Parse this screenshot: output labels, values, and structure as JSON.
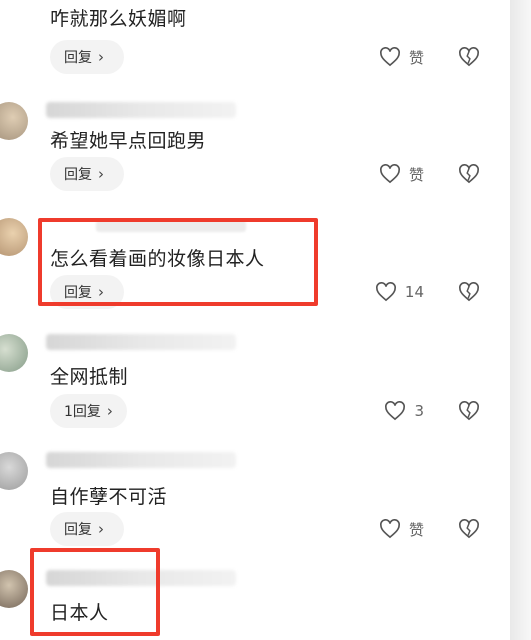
{
  "comments": [
    {
      "text": "咋就那么妖媚啊",
      "reply": "回复",
      "likes": "赞"
    },
    {
      "text": "希望她早点回跑男",
      "reply": "回复",
      "likes": "赞"
    },
    {
      "text": "怎么看着画的妆像日本人",
      "reply": "回复",
      "likes": "14"
    },
    {
      "text": "全网抵制",
      "reply": "1回复",
      "likes": "3"
    },
    {
      "text": "自作孽不可活",
      "reply": "回复",
      "likes": "赞"
    },
    {
      "text": "日本人",
      "reply": "",
      "likes": ""
    }
  ],
  "icons": {
    "reply_arrow": "chevron-right-icon",
    "like": "heart-icon",
    "dislike": "broken-heart-icon"
  },
  "colors": {
    "highlight": "#ef3b2c"
  }
}
